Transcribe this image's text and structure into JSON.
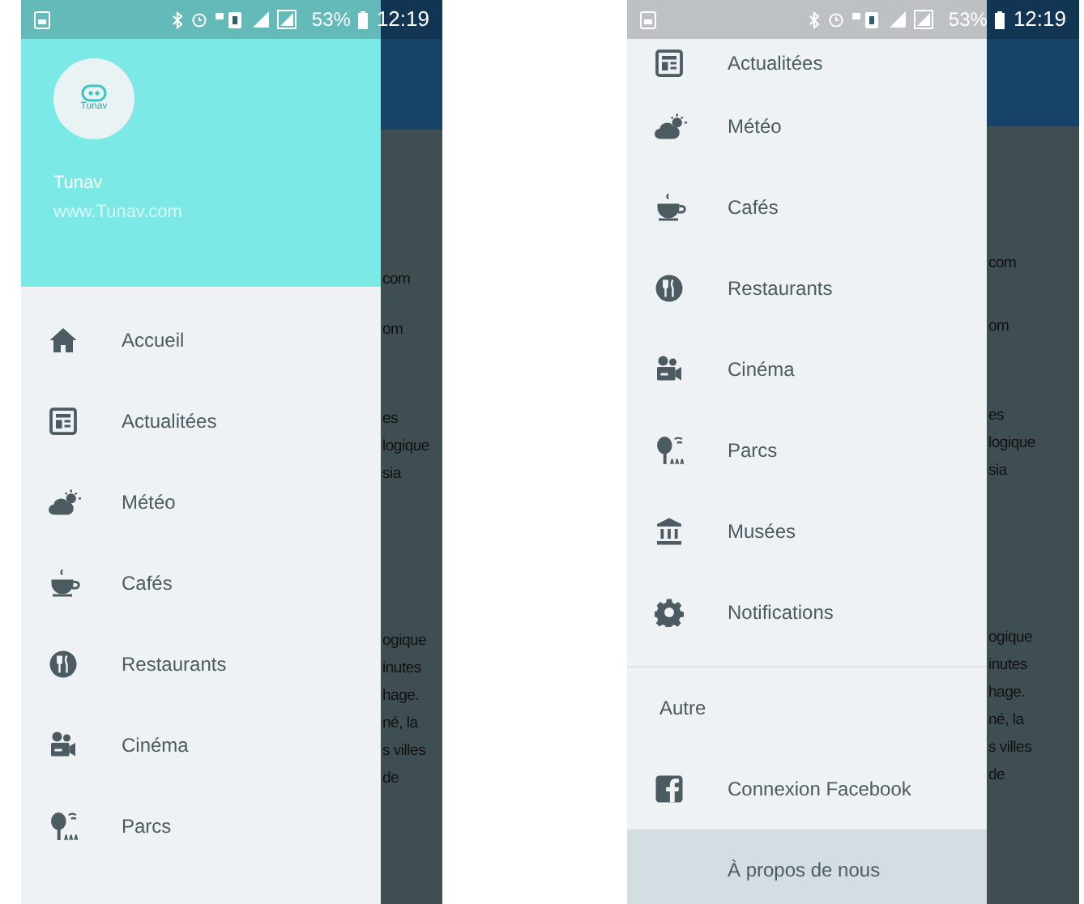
{
  "phones": [
    {
      "status_bar": {
        "battery": "53%",
        "time": "12:19"
      },
      "header": {
        "logo_text": "Tunav",
        "name": "Tunav",
        "url": "www.Tunav.com"
      },
      "items": [
        {
          "kind": "nav",
          "label": "Accueil",
          "selected": false
        },
        {
          "kind": "nav",
          "label": "Actualitées",
          "selected": false
        },
        {
          "kind": "nav",
          "label": "Météo",
          "selected": false
        },
        {
          "kind": "nav",
          "label": "Cafés",
          "selected": false
        },
        {
          "kind": "nav",
          "label": "Restaurants",
          "selected": false
        },
        {
          "kind": "nav",
          "label": "Cinéma",
          "selected": false
        },
        {
          "kind": "nav",
          "label": "Parcs",
          "selected": false
        }
      ],
      "backdrop_paragraphs": [
        [
          "com"
        ],
        [
          "om"
        ],
        [
          "es",
          "logique",
          "sia"
        ],
        [
          "ogique",
          "inutes",
          "hage.",
          "né, la",
          "s villes",
          "de"
        ]
      ]
    },
    {
      "status_bar": {
        "battery": "53%",
        "time": "12:19"
      },
      "items": [
        {
          "kind": "nav",
          "label": "Actualitées",
          "selected": false
        },
        {
          "kind": "nav",
          "label": "Météo",
          "selected": false
        },
        {
          "kind": "nav",
          "label": "Cafés",
          "selected": false
        },
        {
          "kind": "nav",
          "label": "Restaurants",
          "selected": false
        },
        {
          "kind": "nav",
          "label": "Cinéma",
          "selected": false
        },
        {
          "kind": "nav",
          "label": "Parcs",
          "selected": false
        },
        {
          "kind": "nav",
          "label": "Musées",
          "selected": false
        },
        {
          "kind": "nav",
          "label": "Notifications",
          "selected": false
        },
        {
          "kind": "section",
          "label": "Autre"
        },
        {
          "kind": "nav",
          "label": "Connexion Facebook",
          "selected": false
        },
        {
          "kind": "nav",
          "label": "À propos de nous",
          "selected": true
        }
      ],
      "backdrop_paragraphs": [
        [
          "com"
        ],
        [
          "om"
        ],
        [
          "es",
          "logique",
          "sia"
        ],
        [
          "ogique",
          "inutes",
          "hage.",
          "né, la",
          "s villes",
          "de"
        ]
      ]
    }
  ]
}
